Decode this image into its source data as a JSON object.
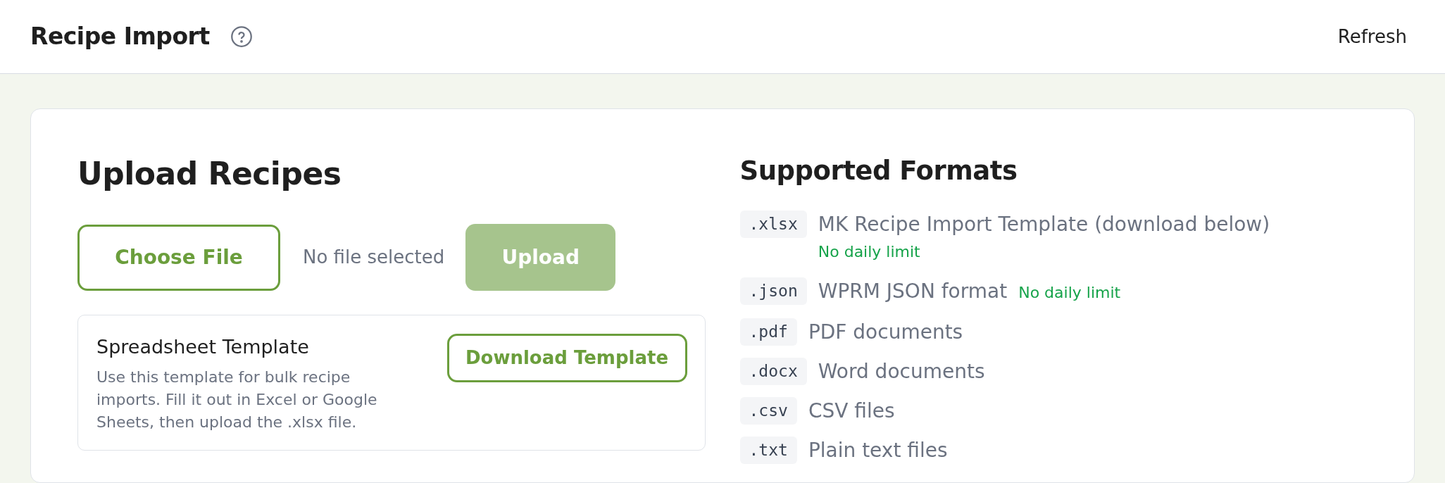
{
  "header": {
    "title": "Recipe Import",
    "refresh": "Refresh"
  },
  "upload": {
    "heading": "Upload Recipes",
    "choose_file": "Choose File",
    "file_status": "No file selected",
    "upload_button": {
      "label": "Upload",
      "disabled": true
    }
  },
  "template": {
    "title": "Spreadsheet Template",
    "description": "Use this template for bulk recipe imports. Fill it out in Excel or Google Sheets, then upload the .xlsx file.",
    "button": "Download Template"
  },
  "formats": {
    "heading": "Supported Formats",
    "items": [
      {
        "extension": ".xlsx",
        "description": "MK Recipe Import Template (download below)",
        "note": "No daily limit"
      },
      {
        "extension": ".json",
        "description": "WPRM JSON format",
        "note": "No daily limit"
      },
      {
        "extension": ".pdf",
        "description": "PDF documents"
      },
      {
        "extension": ".docx",
        "description": "Word documents"
      },
      {
        "extension": ".csv",
        "description": "CSV files"
      },
      {
        "extension": ".txt",
        "description": "Plain text files"
      }
    ]
  }
}
